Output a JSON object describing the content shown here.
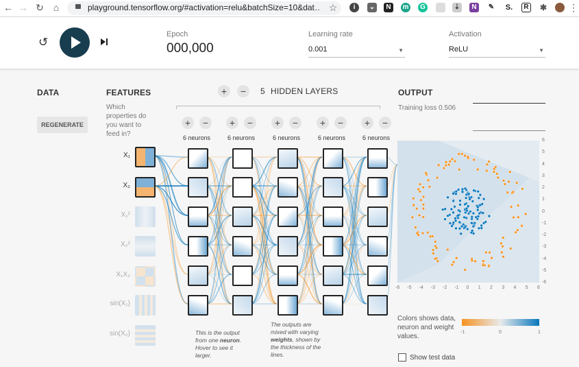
{
  "browser": {
    "url": "playground.tensorflow.org/#activation=relu&batchSize=10&dat…",
    "ext_labels": [
      "N",
      "m",
      "S.",
      "R"
    ]
  },
  "controls": {
    "epoch_label": "Epoch",
    "epoch_value": "000,000",
    "learning_rate_label": "Learning rate",
    "learning_rate_value": "0.001",
    "activation_label": "Activation",
    "activation_value": "ReLU"
  },
  "data_panel": {
    "title": "DATA",
    "regenerate": "REGENERATE"
  },
  "features": {
    "title": "FEATURES",
    "subtitle": "Which properties do you want to feed in?",
    "items": [
      {
        "label": "X₁",
        "active": true
      },
      {
        "label": "X₂",
        "active": true
      },
      {
        "label": "X₁²",
        "active": false
      },
      {
        "label": "X₂²",
        "active": false
      },
      {
        "label": "X₁X₂",
        "active": false
      },
      {
        "label": "sin(X₁)",
        "active": false
      },
      {
        "label": "sin(X₂)",
        "active": false
      }
    ]
  },
  "network": {
    "add_symbol": "+",
    "remove_symbol": "−",
    "layer_count": "5",
    "hidden_layers_label": "HIDDEN LAYERS",
    "layers": [
      {
        "neurons_label": "6 neurons"
      },
      {
        "neurons_label": "6 neurons"
      },
      {
        "neurons_label": "6 neurons"
      },
      {
        "neurons_label": "6 neurons"
      },
      {
        "neurons_label": "6 neurons"
      }
    ],
    "annotation_neuron_pre": "This is the output from one ",
    "annotation_neuron_bold": "neuron",
    "annotation_neuron_post": ". Hover to see it larger.",
    "annotation_weights_pre": "The outputs are mixed with varying ",
    "annotation_weights_bold": "weights",
    "annotation_weights_post": ", shown by the thickness of the lines."
  },
  "output": {
    "title": "OUTPUT",
    "training_loss": "Training loss 0.506",
    "x_ticks": [
      "-6",
      "-5",
      "-4",
      "-3",
      "-2",
      "-1",
      "0",
      "1",
      "2",
      "3",
      "4",
      "5",
      "6"
    ],
    "y_ticks": [
      "6",
      "5",
      "4",
      "3",
      "2",
      "1",
      "0",
      "-1",
      "-2",
      "-3",
      "-4",
      "-5",
      "-6"
    ],
    "colors_text": "Colors shows data, neuron and weight values.",
    "scale_labels": [
      "-1",
      "0",
      "1"
    ],
    "show_test_data": "Show test data",
    "colors": {
      "orange": "#f59322",
      "blue": "#0877bd"
    }
  }
}
